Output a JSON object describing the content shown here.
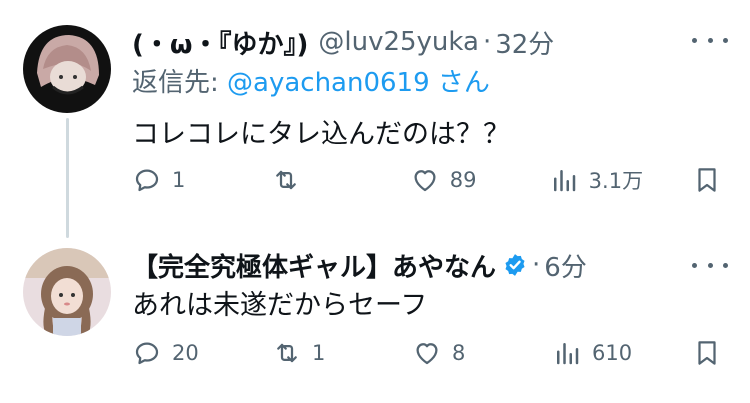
{
  "tweets": [
    {
      "display_name": "(・ω・『ゆか』)",
      "handle": "@luv25yuka",
      "dot": "·",
      "time": "32分",
      "reply_label": "返信先: ",
      "reply_mention": "@ayachan0619",
      "reply_suffix": " さん",
      "text": "コレコレにタレ込んだのは？？",
      "stats": {
        "replies": "1",
        "retweets": "",
        "likes": "89",
        "views": "3.1万"
      }
    },
    {
      "display_name": "【完全究極体ギャル】あやなん",
      "verified": true,
      "dot": "·",
      "time": "6分",
      "text": "あれは未遂だからセーフ",
      "stats": {
        "replies": "20",
        "retweets": "1",
        "likes": "8",
        "views": "610"
      }
    }
  ],
  "colors": {
    "text": "#0f1419",
    "secondary": "#536471",
    "link": "#1d9bf0",
    "thread_line": "#cfd9de"
  },
  "icons": [
    "reply-icon",
    "retweet-icon",
    "like-icon",
    "views-icon",
    "bookmark-icon",
    "more-icon",
    "verified-icon"
  ]
}
